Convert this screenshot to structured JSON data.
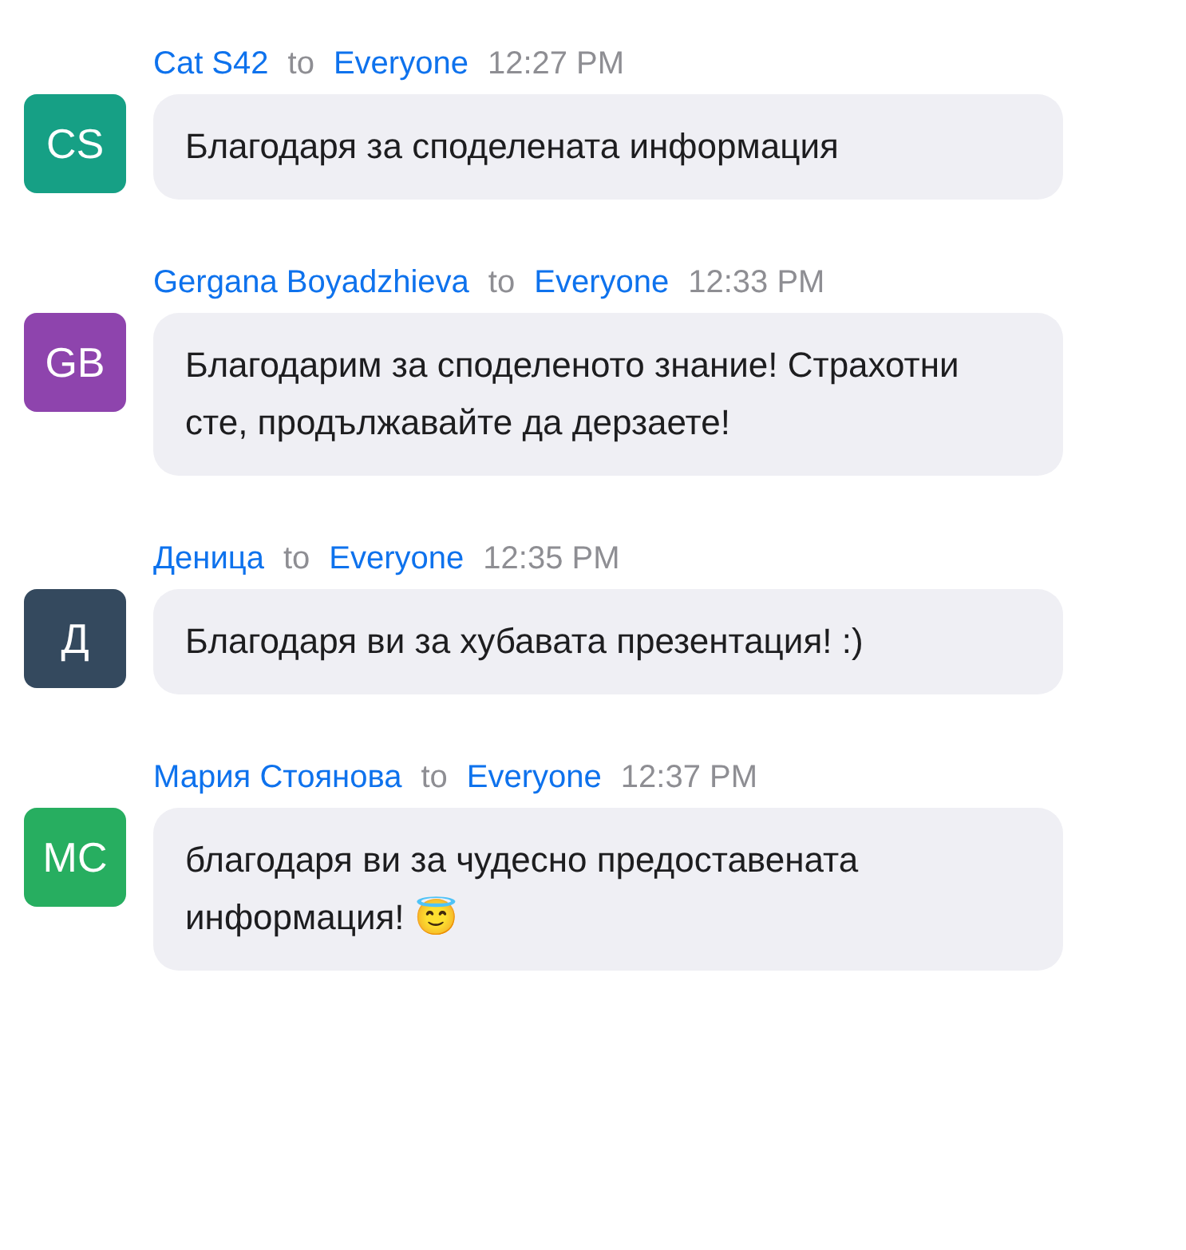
{
  "messages": [
    {
      "sender": "Cat S42",
      "to_word": "to",
      "recipient": "Everyone",
      "time": "12:27 PM",
      "initials": "CS",
      "color": "#16a085",
      "text": "Благодаря за споделената информация"
    },
    {
      "sender": "Gergana Boyadzhieva",
      "to_word": "to",
      "recipient": "Everyone",
      "time": "12:33 PM",
      "initials": "GB",
      "color": "#8e44ad",
      "text": "Благодарим за споделеното знание! Страхотни сте, продължавайте да дерзаете!"
    },
    {
      "sender": "Деница",
      "to_word": "to",
      "recipient": "Everyone",
      "time": "12:35 PM",
      "initials": "Д",
      "color": "#34495e",
      "text": "Благодаря ви за хубавата презентация! :)"
    },
    {
      "sender": "Мария Стоянова",
      "to_word": "to",
      "recipient": "Everyone",
      "time": "12:37 PM",
      "initials": "МС",
      "color": "#27ae60",
      "text": "благодаря ви за чудесно предоставената информация! 😇"
    }
  ]
}
